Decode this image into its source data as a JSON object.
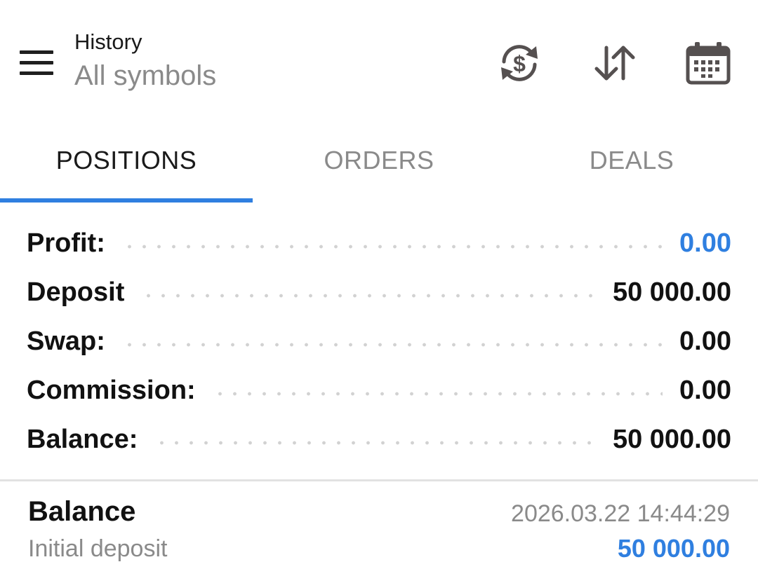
{
  "header": {
    "title": "History",
    "subtitle": "All symbols",
    "menu_icon": "hamburger-menu-icon",
    "actions": [
      {
        "icon": "currency-exchange-icon"
      },
      {
        "icon": "sort-arrows-icon"
      },
      {
        "icon": "calendar-icon"
      }
    ]
  },
  "tabs": [
    {
      "label": "POSITIONS",
      "active": true
    },
    {
      "label": "ORDERS",
      "active": false
    },
    {
      "label": "DEALS",
      "active": false
    }
  ],
  "summary": {
    "profit": {
      "label": "Profit:",
      "value": "0.00"
    },
    "deposit": {
      "label": "Deposit",
      "value": "50 000.00"
    },
    "swap": {
      "label": "Swap:",
      "value": "0.00"
    },
    "commission": {
      "label": "Commission:",
      "value": "0.00"
    },
    "balance": {
      "label": "Balance:",
      "value": "50 000.00"
    }
  },
  "deal": {
    "type": "Balance",
    "time": "2026.03.22 14:44:29",
    "comment": "Initial deposit",
    "amount": "50 000.00"
  },
  "colors": {
    "accent": "#2f7fe0",
    "text": "#111111",
    "muted": "#8a8a8a",
    "icon": "#555050"
  }
}
